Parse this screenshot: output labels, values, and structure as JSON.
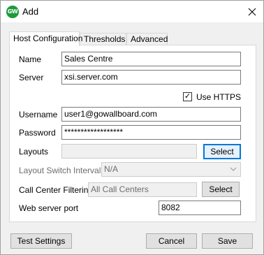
{
  "window": {
    "title": "Add",
    "app_icon_text": "GW"
  },
  "tabs": [
    {
      "label": "Host Configuration",
      "active": true
    },
    {
      "label": "Thresholds",
      "active": false
    },
    {
      "label": "Advanced",
      "active": false
    }
  ],
  "form": {
    "name_label": "Name",
    "name_value": "Sales Centre",
    "server_label": "Server",
    "server_value": "xsi.server.com",
    "use_https_label": "Use HTTPS",
    "use_https_checked": true,
    "use_https_mark": "✓",
    "username_label": "Username",
    "username_value": "user1@gowallboard.com",
    "password_label": "Password",
    "password_value": "******************",
    "layouts_label": "Layouts",
    "layouts_value": "",
    "layouts_select_label": "Select",
    "layout_switch_label": "Layout Switch Interval",
    "layout_switch_value": "N/A",
    "call_center_label": "Call Center Filtering",
    "call_center_value": "All Call Centers",
    "call_center_select_label": "Select",
    "web_port_label": "Web server port",
    "web_port_value": "8082"
  },
  "footer": {
    "test_settings_label": "Test Settings",
    "cancel_label": "Cancel",
    "save_label": "Save"
  },
  "colors": {
    "accent": "#0078d7",
    "app_icon": "#1e9a3c",
    "dialog_bg": "#f0f0f0"
  }
}
